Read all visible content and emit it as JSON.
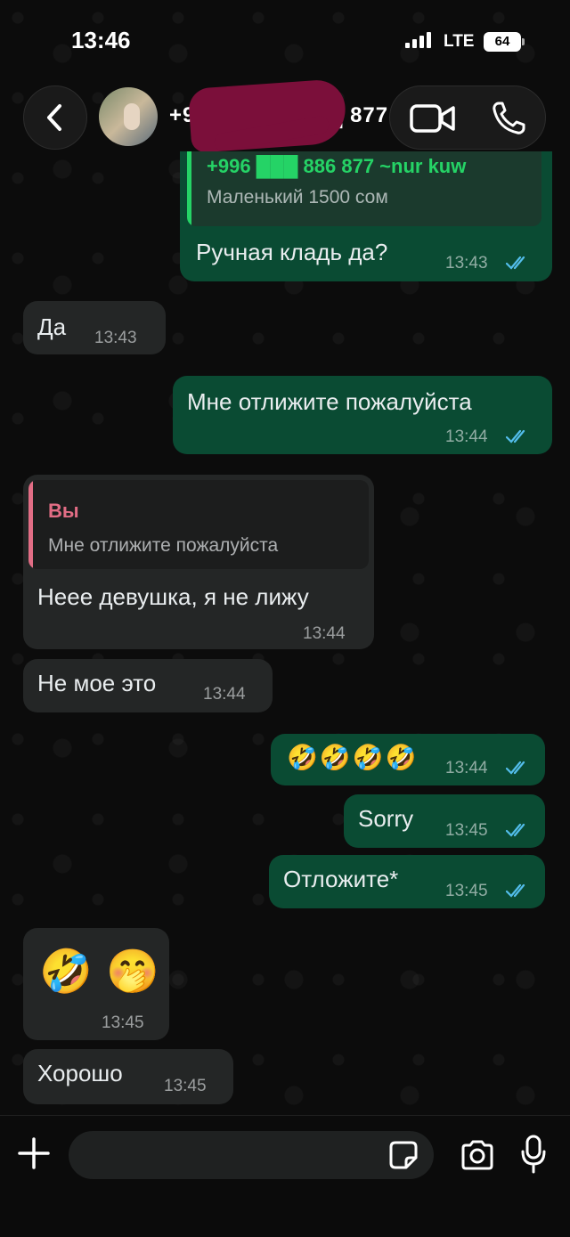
{
  "status_bar": {
    "time": "13:46",
    "network": "LTE",
    "battery": "64"
  },
  "header": {
    "contact_name": "+99 ████████ 877",
    "avatar": "contact-photo"
  },
  "colors": {
    "outgoing_bubble": "#0a4b33",
    "incoming_bubble": "#242626",
    "read_ticks": "#53bdeb",
    "quote_you": "#e26d85",
    "quote_other": "#25d366"
  },
  "messages": [
    {
      "id": "m1",
      "direction": "out",
      "quote_author": "+996 ███ 886 877 ~nur kuw",
      "quote_text": "Маленький 1500 сом",
      "text": "Ручная кладь да?",
      "time": "13:43",
      "status": "read"
    },
    {
      "id": "m2",
      "direction": "in",
      "text": "Да",
      "time": "13:43"
    },
    {
      "id": "m3",
      "direction": "out",
      "text": "Мне отлижите пожалуйста",
      "time": "13:44",
      "status": "read"
    },
    {
      "id": "m4",
      "direction": "in",
      "quote_author": "Вы",
      "quote_text": "Мне отлижите пожалуйста",
      "text": "Неее девушка, я не лижу",
      "time": "13:44"
    },
    {
      "id": "m5",
      "direction": "in",
      "text": "Не мое это",
      "time": "13:44"
    },
    {
      "id": "m6",
      "direction": "out",
      "text": "🤣🤣🤣🤣",
      "time": "13:44",
      "status": "read"
    },
    {
      "id": "m7",
      "direction": "out",
      "text": "Sorry",
      "time": "13:45",
      "status": "read"
    },
    {
      "id": "m8",
      "direction": "out",
      "text": "Отложите*",
      "time": "13:45",
      "status": "read"
    },
    {
      "id": "m9",
      "direction": "in",
      "text": "🤣 🤭",
      "time": "13:45"
    },
    {
      "id": "m10",
      "direction": "in",
      "text": "Хорошо",
      "time": "13:45"
    }
  ],
  "input_bar": {
    "placeholder": ""
  },
  "icons": {
    "back": "chevron-left-icon",
    "video": "video-camera-icon",
    "voice": "phone-icon",
    "plus": "plus-icon",
    "sticker": "sticker-icon",
    "camera": "camera-icon",
    "mic": "microphone-icon"
  }
}
